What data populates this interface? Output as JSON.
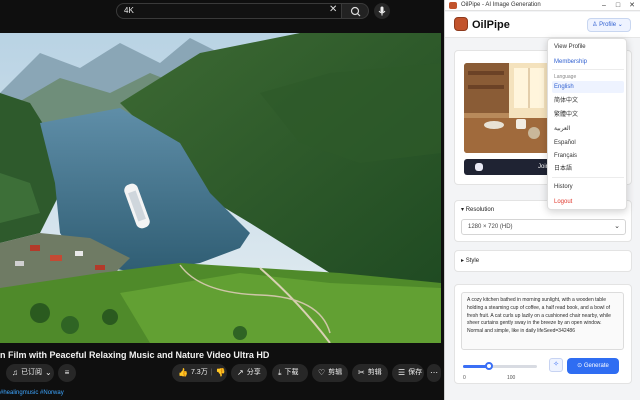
{
  "youtube": {
    "search_value": "4K",
    "clear_icon": "close-icon",
    "video_title": "n Film with Peaceful Relaxing Music and Nature Video Ultra HD",
    "subscribe_label": "已订阅",
    "likes": "7.3万",
    "share_label": "分享",
    "download_label": "下载",
    "clip_label": "剪辑",
    "shorts_label": "剪辑",
    "save_label": "保存",
    "channel_tags": "#healingmusic #Norway"
  },
  "extension": {
    "window_title": "OilPipe - AI Image Generation",
    "brand": "OilPipe",
    "profile_label": "Profile",
    "join_label": "Join",
    "resolution_label": "Resolution",
    "resolution_value": "1280 × 720 (HD)",
    "style_label": "Style",
    "prompt_text": "A cozy kitchen bathed in morning sunlight, with a wooden table holding a steaming cup of coffee, a half read book, and a bowl of fresh fruit. A cat curls up lazily on a cushioned chair nearby, while sheer curtains gently sway in the breeze by an open window. Normal and simple, like in daily lifeSeed=342486",
    "slider_min": "0",
    "slider_max": "100",
    "slider_value_fraction": 0.35,
    "generate_label": "Generate",
    "menu": {
      "view_profile": "View Profile",
      "membership": "Membership",
      "language_header": "Language",
      "languages": [
        "English",
        "简体中文",
        "繁體中文",
        "العربية",
        "Español",
        "Français",
        "日本語"
      ],
      "selected_language": "English",
      "history": "History",
      "logout": "Logout"
    }
  },
  "colors": {
    "accent": "#2f6df2",
    "logout": "#e03a2f",
    "brand_logo": "#c2532c",
    "yt_background": "#0f0f0f"
  }
}
